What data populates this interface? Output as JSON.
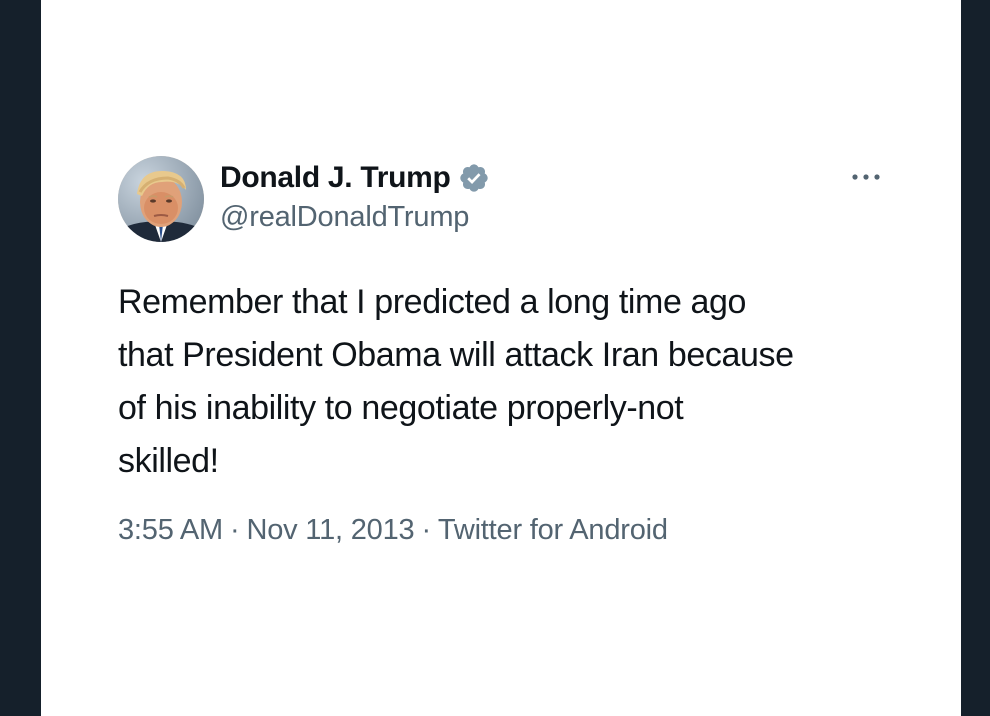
{
  "tweet": {
    "author": {
      "display_name": "Donald J. Trump",
      "handle": "@realDonaldTrump",
      "verified": true,
      "avatar_icon": "profile-photo"
    },
    "text": "Remember that I predicted a long time ago\nthat President Obama will attack Iran because\nof his inability to negotiate properly-not\nskilled!",
    "time": "3:55 AM",
    "separator": "·",
    "date": "Nov 11, 2013",
    "source": "Twitter for Android",
    "more_icon": "more-horizontal-icon"
  },
  "colors": {
    "background": "#15202b",
    "card": "#ffffff",
    "text_primary": "#0f1419",
    "text_secondary": "#536471",
    "verified_badge": "#829aab"
  }
}
